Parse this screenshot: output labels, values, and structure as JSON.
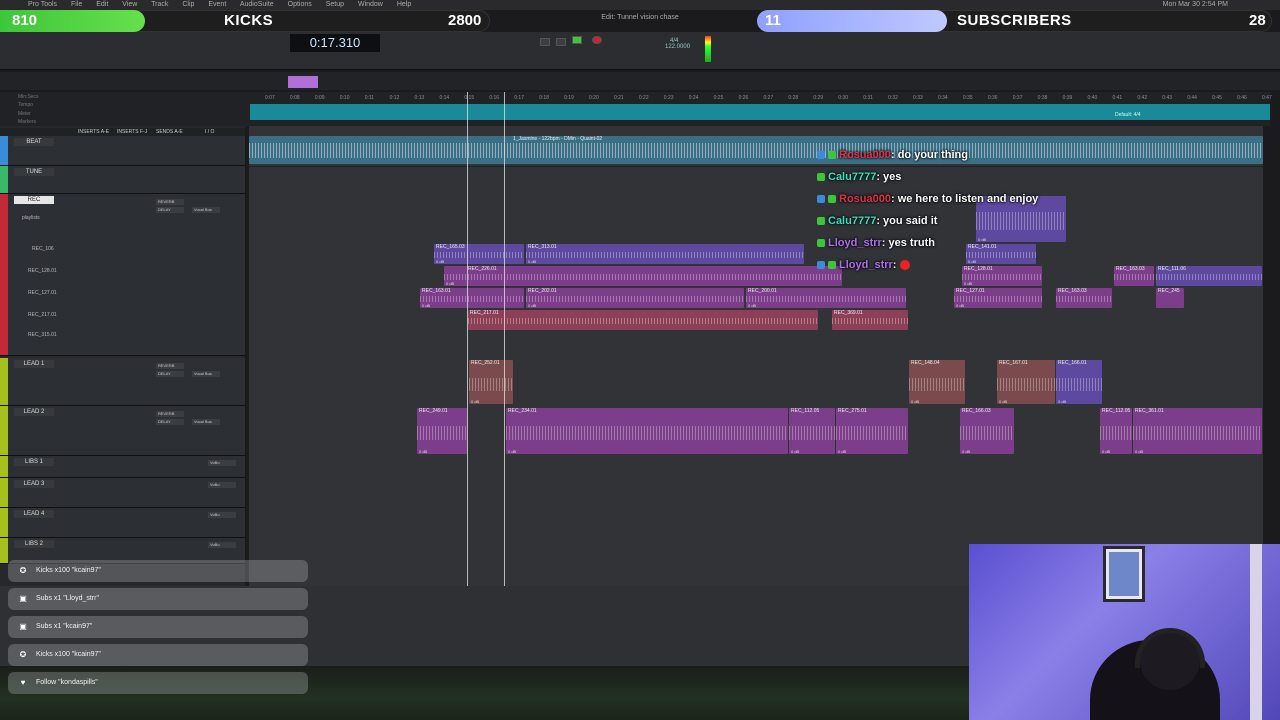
{
  "menubar": {
    "items": [
      "Pro Tools",
      "File",
      "Edit",
      "View",
      "Track",
      "Clip",
      "Event",
      "AudioSuite",
      "Options",
      "Setup",
      "Window",
      "Help"
    ],
    "clock": "Mon Mar 30  2:54 PM"
  },
  "overlay": {
    "kicks": {
      "count": "810",
      "title": "KICKS",
      "goal": "2800",
      "color": "#4ed43f"
    },
    "subs": {
      "count": "11",
      "title": "SUBSCRIBERS",
      "goal": "28",
      "color": "#a9b4ff"
    }
  },
  "transport": {
    "edit_window_title": "Edit: Tunnel vision chase",
    "main_counter": "0:17.310",
    "tempo": "122.0000",
    "meter": "4/4"
  },
  "timeline": {
    "ruler_labels": [
      "Min:Secs",
      "Tempo",
      "Meter",
      "Markers"
    ],
    "ticks": [
      "0:07",
      "0:08",
      "0:09",
      "0:10",
      "0:11",
      "0:12",
      "0:13",
      "0:14",
      "0:15",
      "0:16",
      "0:17",
      "0:18",
      "0:19",
      "0:20",
      "0:21",
      "0:22",
      "0:23",
      "0:24",
      "0:25",
      "0:26",
      "0:27",
      "0:28",
      "0:29",
      "0:30",
      "0:31",
      "0:32",
      "0:33",
      "0:34",
      "0:35",
      "0:36",
      "0:37",
      "0:38",
      "0:39",
      "0:40",
      "0:41",
      "0:42",
      "0:43",
      "0:44",
      "0:45",
      "0:46",
      "0:47"
    ],
    "default_meter": "Default: 4/4"
  },
  "columns": [
    "INSERTS A-E",
    "INSERTS F-J",
    "SENDS A-E",
    "I / O"
  ],
  "tracks": [
    {
      "name": "BEAT",
      "color": "#3a8bd8",
      "inserts": [],
      "sends": []
    },
    {
      "name": "TUNE",
      "color": "#3ab86a",
      "inserts": [],
      "sends": []
    },
    {
      "name": "REC",
      "color": "#c22a3a",
      "playlist": "playlists",
      "inserts": [
        "REVERB",
        "DELAY"
      ],
      "sends": [
        "Vocal Bus"
      ]
    },
    {
      "name": "LEAD 1",
      "color": "#a6c020",
      "inserts": [
        "REVERB",
        "DELAY"
      ],
      "sends": [
        "Vocal Bus"
      ]
    },
    {
      "name": "LEAD 2",
      "color": "#a6c020",
      "inserts": [
        "REVERB",
        "DELAY"
      ],
      "sends": [
        "Vocal Bus"
      ]
    },
    {
      "name": "LIBS 1",
      "color": "#a6c020",
      "inserts": [],
      "sends": [
        "VoBo"
      ]
    },
    {
      "name": "LEAD 3",
      "color": "#a6c020",
      "inserts": [],
      "sends": [
        "VoBo"
      ]
    },
    {
      "name": "LEAD 4",
      "color": "#a6c020",
      "inserts": [],
      "sends": [
        "VoBo"
      ]
    },
    {
      "name": "LIBS 2",
      "color": "#a6c020",
      "inserts": [],
      "sends": [
        "VoBo"
      ]
    }
  ],
  "subtracks": [
    "REC_106",
    "REC_128.01",
    "REC_127.01",
    "REC_217.01",
    "REC_315.01"
  ],
  "clips": {
    "beat_header": "1_Jasmine - 122bpm - DMin - Quaint-02",
    "rec": [
      "REC_165.03",
      "REC_313.01",
      "REC_226.01",
      "REC_163.01",
      "REC_202.01",
      "REC_200.01",
      "REC_217.01",
      "REC_141.01",
      "REC_128.01",
      "REC_163.03",
      "REC_111.06",
      "REC_127.01",
      "REC_245",
      "REC_369.01"
    ],
    "lead1": [
      "REC_252.01",
      "REC_148.04",
      "REC_167.01",
      "REC_166.01"
    ],
    "lead2": [
      "REC_249.01",
      "REC_234.01",
      "REC_112.05",
      "REC_275.01",
      "REC_166.03",
      "REC_112.05",
      "REC_361.01"
    ],
    "gain": "0 dB"
  },
  "chat": [
    {
      "user": "Rosua000",
      "color": "#e0304a",
      "message": ": do your thing"
    },
    {
      "user": "Calu7777",
      "color": "#36e0c0",
      "message": ":   yes"
    },
    {
      "user": "Rosua000",
      "color": "#e0304a",
      "message": ": we here to listen and enjoy"
    },
    {
      "user": "Calu7777",
      "color": "#36e0c0",
      "message": ": you said it"
    },
    {
      "user": "Lloyd_strr",
      "color": "#b06cf0",
      "message": ": yes truth"
    },
    {
      "user": "Lloyd_strr",
      "color": "#b06cf0",
      "message": ": "
    }
  ],
  "alerts": [
    {
      "icon": "kick-icon",
      "glyph": "✪",
      "text": "Kicks x100 \"kcain97\""
    },
    {
      "icon": "gift-icon",
      "glyph": "▣",
      "text": "Subs x1 \"Lloyd_strr\""
    },
    {
      "icon": "gift-icon",
      "glyph": "▣",
      "text": "Subs x1 \"kcain97\""
    },
    {
      "icon": "kick-icon",
      "glyph": "✪",
      "text": "Kicks x100 \"kcain97\""
    },
    {
      "icon": "heart-icon",
      "glyph": "♥",
      "text": "Follow \"kondaspills\""
    }
  ]
}
